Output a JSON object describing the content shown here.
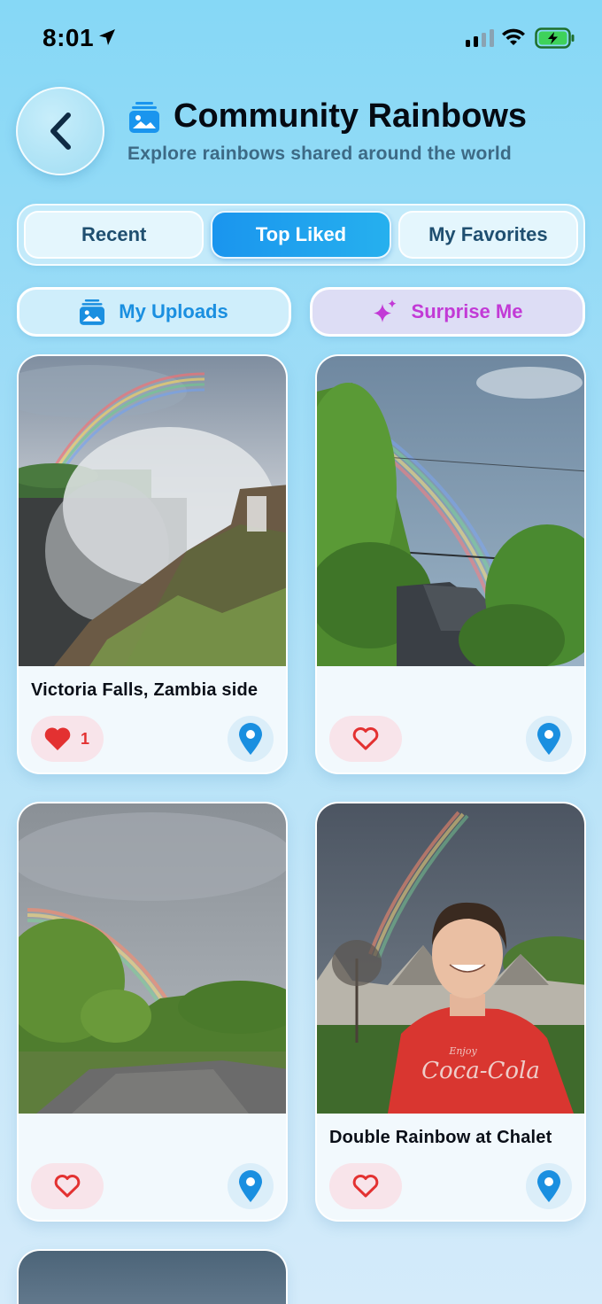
{
  "status_bar": {
    "time": "8:01"
  },
  "header": {
    "title": "Community Rainbows",
    "subtitle": "Explore rainbows shared around the world"
  },
  "tabs": [
    {
      "label": "Recent",
      "active": false
    },
    {
      "label": "Top Liked",
      "active": true
    },
    {
      "label": "My Favorites",
      "active": false
    }
  ],
  "actions": {
    "uploads_label": "My Uploads",
    "surprise_label": "Surprise Me"
  },
  "cards": [
    {
      "caption": "Victoria Falls, Zambia side",
      "likes": "1",
      "liked": true
    },
    {
      "caption": "",
      "likes": "",
      "liked": false
    },
    {
      "caption": "",
      "likes": "",
      "liked": false
    },
    {
      "caption": "Double Rainbow at Chalet",
      "likes": "",
      "liked": false
    }
  ],
  "colors": {
    "accent": "#1a95ee",
    "surprise": "#c23ad6",
    "like": "#e33131"
  }
}
